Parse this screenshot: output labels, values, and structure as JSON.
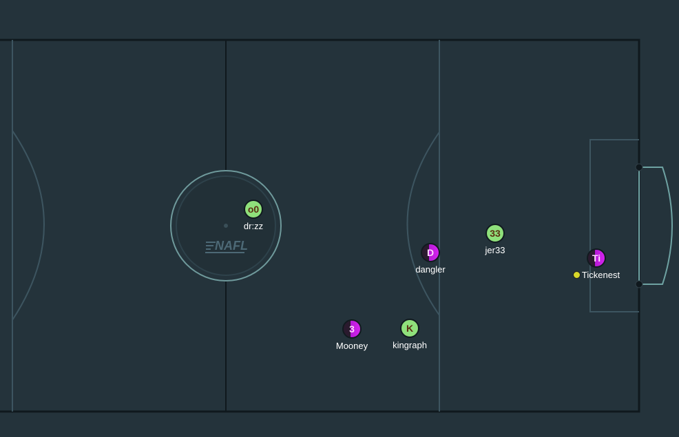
{
  "logo": {
    "text": "NAFL"
  },
  "players": [
    {
      "id": "p1",
      "badge": "o0",
      "name": "dr:zz",
      "team": "green"
    },
    {
      "id": "p2",
      "badge": "33",
      "name": "jer33",
      "team": "green"
    },
    {
      "id": "p3",
      "badge": "D",
      "name": "dangler",
      "team": "purple"
    },
    {
      "id": "p4",
      "badge": "Ti",
      "name": "Tickenest",
      "team": "purple",
      "has_ball": true
    },
    {
      "id": "p5",
      "badge": "3",
      "name": "Mooney",
      "team": "purple"
    },
    {
      "id": "p6",
      "badge": "K",
      "name": "kingraph",
      "team": "green"
    }
  ],
  "colors": {
    "background": "#24333b",
    "pitch_line": "#0f181d",
    "faint_line": "#3d5560",
    "goal_line": "#6fa3a3",
    "green_team": "#8fe07b",
    "purple_team": "#c21fe0",
    "ball": "#d8d82a"
  }
}
